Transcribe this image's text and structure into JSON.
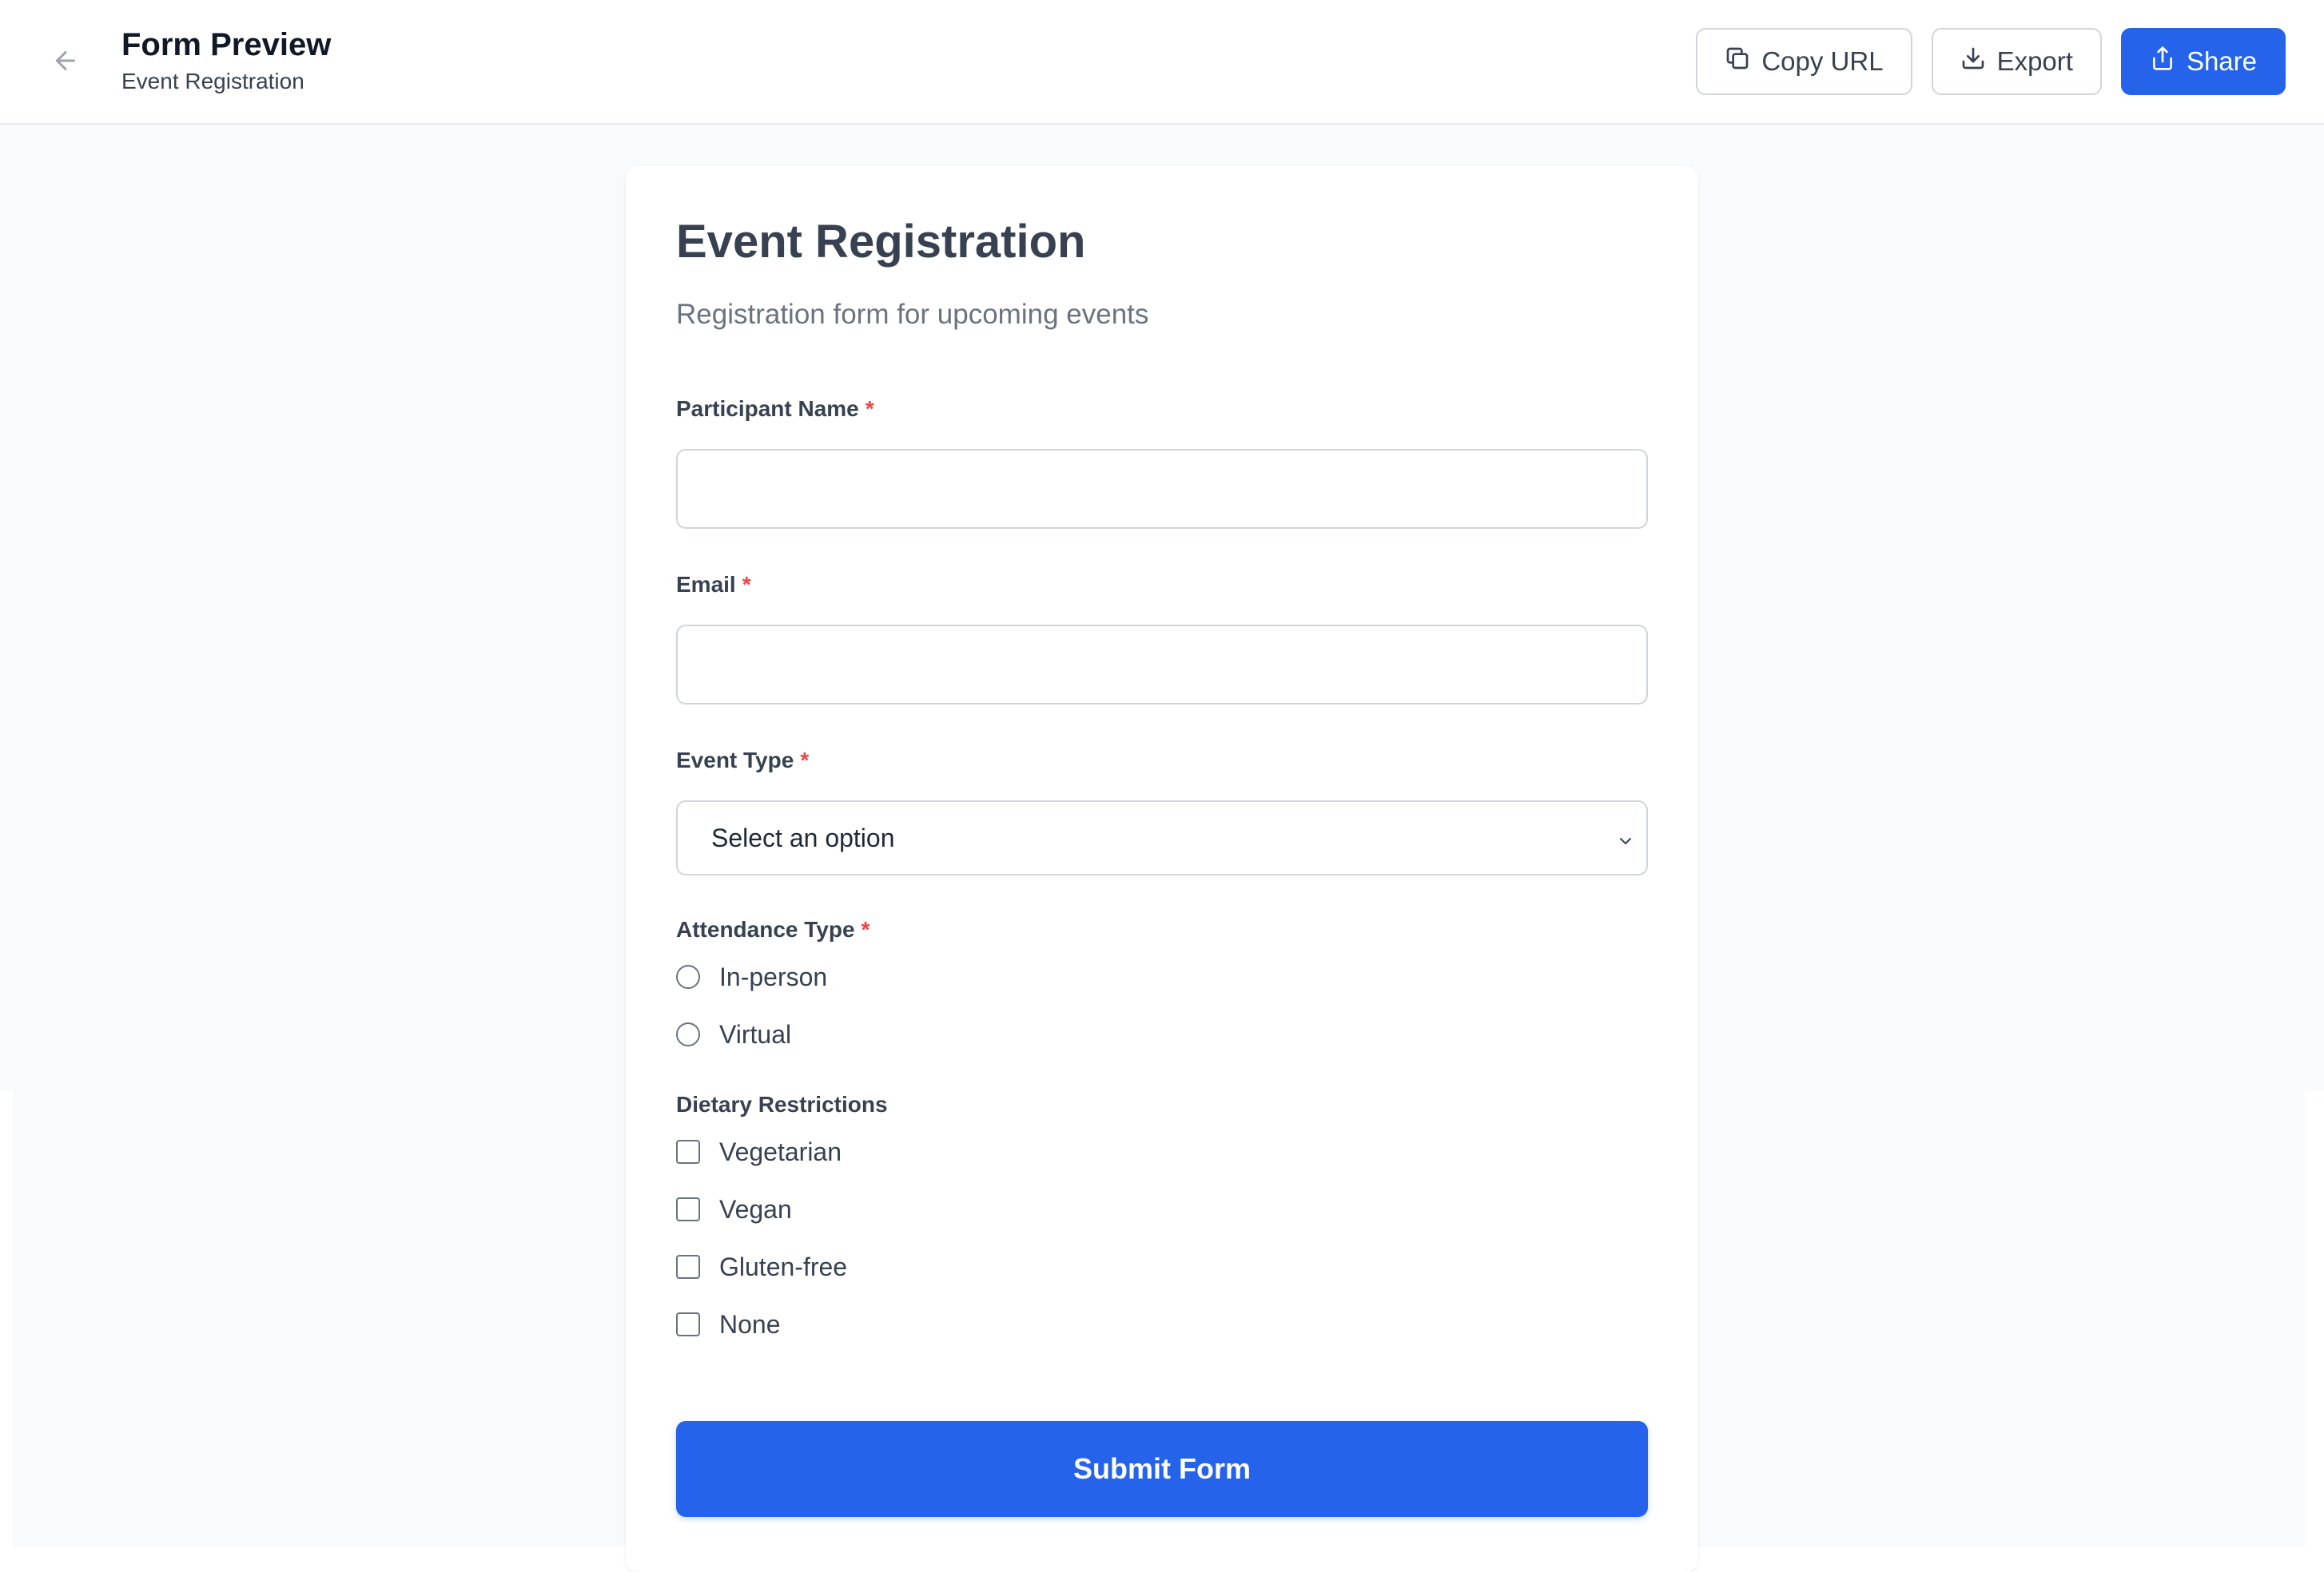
{
  "header": {
    "title": "Form Preview",
    "subtitle": "Event Registration",
    "actions": [
      {
        "label": "Copy URL",
        "icon": "copy-icon"
      },
      {
        "label": "Export",
        "icon": "download-icon"
      },
      {
        "label": "Share",
        "icon": "share-icon"
      }
    ]
  },
  "form": {
    "title": "Event Registration",
    "description": "Registration form for upcoming events",
    "fields": {
      "participant_name": {
        "label": "Participant Name",
        "required_mark": "*",
        "value": ""
      },
      "email": {
        "label": "Email",
        "required_mark": "*",
        "value": ""
      },
      "event_type": {
        "label": "Event Type",
        "required_mark": "*",
        "selected": "Select an option"
      },
      "attendance_type": {
        "label": "Attendance Type",
        "required_mark": "*",
        "options": [
          {
            "label": "In-person",
            "checked": false
          },
          {
            "label": "Virtual",
            "checked": false
          }
        ]
      },
      "dietary_restrictions": {
        "label": "Dietary Restrictions",
        "options": [
          {
            "label": "Vegetarian",
            "checked": false
          },
          {
            "label": "Vegan",
            "checked": false
          },
          {
            "label": "Gluten-free",
            "checked": false
          },
          {
            "label": "None",
            "checked": false
          }
        ]
      }
    },
    "submit_label": "Submit Form"
  },
  "colors": {
    "primary": "#2563eb",
    "required": "#ef4444",
    "page_background": "#f9fafb"
  }
}
